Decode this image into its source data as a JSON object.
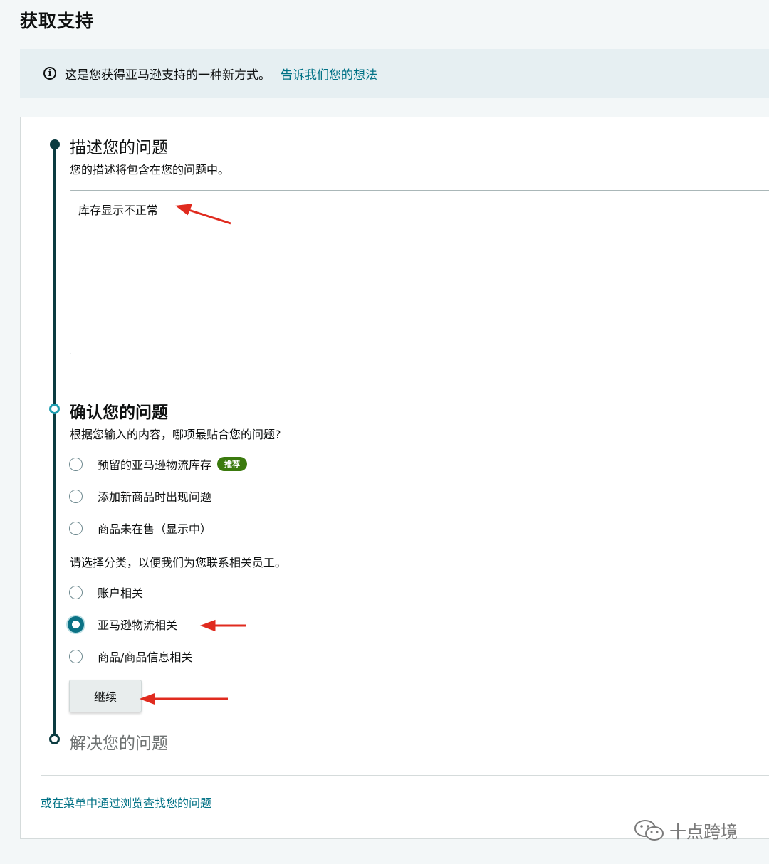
{
  "page": {
    "title": "获取支持"
  },
  "banner": {
    "icon": "info-icon",
    "text": "这是您获得亚马逊支持的一种新方式。",
    "link": "告诉我们您的想法"
  },
  "step1": {
    "title": "描述您的问题",
    "desc": "您的描述将包含在您的问题中。",
    "textarea_value": "库存显示不正常"
  },
  "step2": {
    "title": "确认您的问题",
    "desc": "根据您输入的内容，哪项最贴合您的问题?",
    "suggested": [
      {
        "label": "预留的亚马逊物流库存",
        "badge": "推荐",
        "checked": false
      },
      {
        "label": "添加新商品时出现问题",
        "checked": false
      },
      {
        "label": "商品未在售（显示中）",
        "checked": false
      }
    ],
    "category_label": "请选择分类，以便我们为您联系相关员工。",
    "categories": [
      {
        "label": "账户相关",
        "checked": false
      },
      {
        "label": "亚马逊物流相关",
        "checked": true
      },
      {
        "label": "商品/商品信息相关",
        "checked": false
      }
    ],
    "continue_label": "继续"
  },
  "step3": {
    "title": "解决您的问题"
  },
  "footer": {
    "browse_link": "或在菜单中通过浏览查找您的问题"
  },
  "watermark": {
    "text": "十点跨境",
    "icon": "wechat-icon"
  },
  "colors": {
    "accent": "#007185",
    "timeline": "#0b3b40",
    "badge": "#3b7a0e",
    "arrow": "#e02b1f"
  }
}
